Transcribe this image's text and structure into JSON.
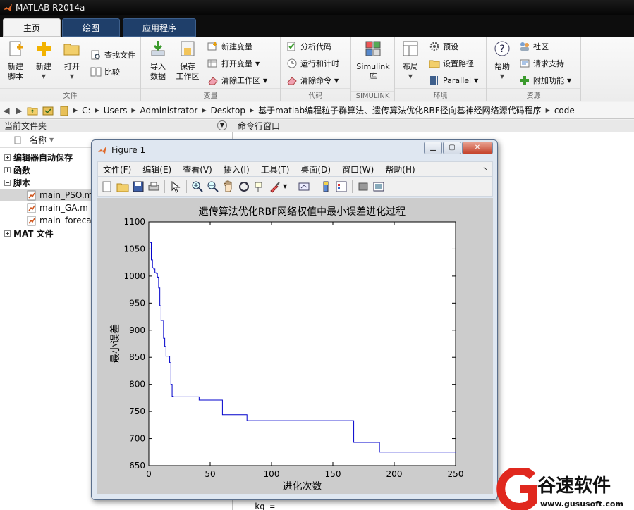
{
  "app": {
    "title": "MATLAB R2014a"
  },
  "tabs": [
    {
      "label": "主页"
    },
    {
      "label": "绘图"
    },
    {
      "label": "应用程序"
    }
  ],
  "ribbon": {
    "file": {
      "label": "文件",
      "new_script": "新建\n脚本",
      "new": "新建",
      "open": "打开",
      "find_files": "查找文件",
      "compare": "比较"
    },
    "variable": {
      "label": "变量",
      "import": "导入\n数据",
      "save": "保存\n工作区",
      "new_var": "新建变量",
      "open_var": "打开变量",
      "clear_ws": "清除工作区"
    },
    "code": {
      "label": "代码",
      "analyze": "分析代码",
      "run_time": "运行和计时",
      "clear_cmd": "清除命令"
    },
    "simulink": {
      "label": "SIMULINK",
      "lib": "Simulink\n库"
    },
    "environment": {
      "label": "环境",
      "layout": "布局",
      "prefs": "预设",
      "set_path": "设置路径",
      "parallel": "Parallel"
    },
    "resources": {
      "label": "资源",
      "help": "帮助",
      "community": "社区",
      "support": "请求支持",
      "addons": "附加功能"
    }
  },
  "address": {
    "crumbs": [
      "C:",
      "Users",
      "Administrator",
      "Desktop",
      "基于matlab编程粒子群算法、遗传算法优化RBF径向基神经网络源代码程序",
      "code"
    ]
  },
  "folder_panel": {
    "title": "当前文件夹",
    "column": "名称",
    "groups": [
      {
        "label": "编辑器自动保存",
        "expander": "+"
      },
      {
        "label": "函数",
        "expander": "+"
      },
      {
        "label": "脚本",
        "expander": "−"
      },
      {
        "label": "MAT 文件",
        "expander": "+"
      }
    ],
    "files": [
      "main_PSO.m",
      "main_GA.m",
      "main_forecast.m"
    ]
  },
  "command_window": {
    "title": "命令行窗口",
    "last_line": "kg ="
  },
  "figure": {
    "title": "Figure 1",
    "menu": [
      "文件(F)",
      "编辑(E)",
      "查看(V)",
      "插入(I)",
      "工具(T)",
      "桌面(D)",
      "窗口(W)",
      "帮助(H)"
    ]
  },
  "chart_data": {
    "type": "line",
    "title": "遗传算法优化RBF网络权值中最小误差进化过程",
    "xlabel": "进化次数",
    "ylabel": "最小误差",
    "xlim": [
      0,
      250
    ],
    "ylim": [
      650,
      1100
    ],
    "xticks": [
      0,
      50,
      100,
      150,
      200,
      250
    ],
    "yticks": [
      650,
      700,
      750,
      800,
      850,
      900,
      950,
      1000,
      1050,
      1100
    ],
    "color": "#0000cc",
    "series": [
      {
        "x": [
          1,
          2,
          3,
          4,
          5,
          6,
          7,
          8,
          9,
          10,
          11,
          12,
          13,
          14,
          15,
          16,
          17,
          18,
          19,
          20,
          40,
          41,
          59,
          60,
          79,
          80,
          166,
          167,
          187,
          188,
          250
        ],
        "y": [
          1062,
          1030,
          1015,
          1013,
          1006,
          1005,
          998,
          978,
          945,
          918,
          918,
          885,
          870,
          852,
          852,
          852,
          840,
          800,
          778,
          777,
          777,
          771,
          771,
          744,
          744,
          733,
          733,
          693,
          693,
          675,
          674
        ]
      }
    ]
  },
  "watermark": {
    "brand": "谷速软件",
    "url": "www.gususoft.com",
    "accent": "#e0281e"
  }
}
